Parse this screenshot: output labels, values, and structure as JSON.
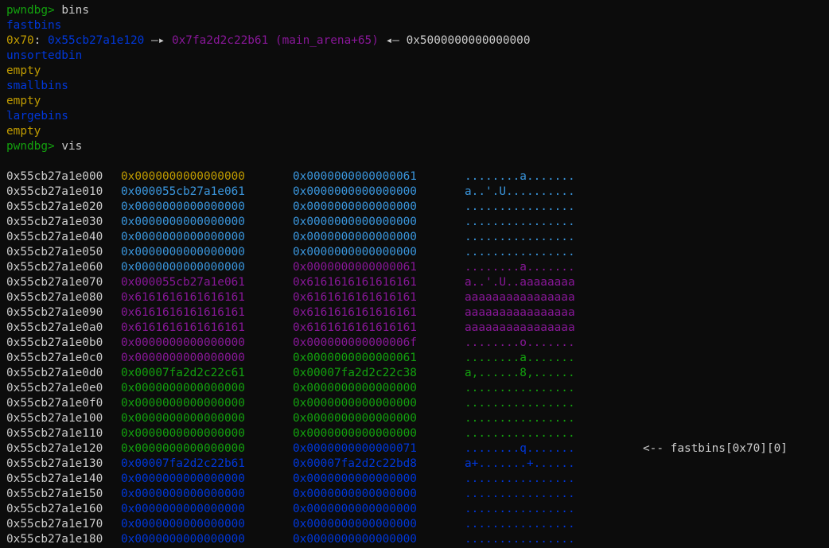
{
  "prompt": "pwndbg>",
  "bins_cmd": {
    "command": "bins",
    "fastbins_label": "fastbins",
    "fastbin_size": "0x70",
    "fastbin_colon": ":",
    "fastbin_chunk": "0x55cb27a1e120",
    "arrow1": "—▸",
    "fastbin_target": "0x7fa2d2c22b61 (main_arena+65)",
    "arrow2": "◂—",
    "fastbin_value": "0x5000000000000000",
    "unsortedbin_label": "unsortedbin",
    "unsortedbin_value": "empty",
    "smallbins_label": "smallbins",
    "smallbins_value": "empty",
    "largebins_label": "largebins",
    "largebins_value": "empty"
  },
  "vis_cmd": {
    "command": "vis"
  },
  "colors": {
    "prompt": "#13a10e",
    "text": "#cccccc",
    "label_blue": "#0037da",
    "empty_yellow": "#c19c00",
    "chunk_top_yellow": "#c19c00",
    "chunk_cyan": "#3a96dd",
    "chunk_purple": "#881798",
    "chunk_green": "#13a10e",
    "chunk_blue": "#0037da"
  },
  "rows": [
    {
      "addr": "0x55cb27a1e000",
      "q1": "0x0000000000000000",
      "q2": "0x0000000000000061",
      "ascii": "........a.......",
      "c1": "yellow",
      "c2": "cyan",
      "ca": "cyan",
      "anno": ""
    },
    {
      "addr": "0x55cb27a1e010",
      "q1": "0x000055cb27a1e061",
      "q2": "0x0000000000000000",
      "ascii": "a..'.U..........",
      "c1": "cyan",
      "c2": "cyan",
      "ca": "cyan",
      "anno": ""
    },
    {
      "addr": "0x55cb27a1e020",
      "q1": "0x0000000000000000",
      "q2": "0x0000000000000000",
      "ascii": "................",
      "c1": "cyan",
      "c2": "cyan",
      "ca": "cyan",
      "anno": ""
    },
    {
      "addr": "0x55cb27a1e030",
      "q1": "0x0000000000000000",
      "q2": "0x0000000000000000",
      "ascii": "................",
      "c1": "cyan",
      "c2": "cyan",
      "ca": "cyan",
      "anno": ""
    },
    {
      "addr": "0x55cb27a1e040",
      "q1": "0x0000000000000000",
      "q2": "0x0000000000000000",
      "ascii": "................",
      "c1": "cyan",
      "c2": "cyan",
      "ca": "cyan",
      "anno": ""
    },
    {
      "addr": "0x55cb27a1e050",
      "q1": "0x0000000000000000",
      "q2": "0x0000000000000000",
      "ascii": "................",
      "c1": "cyan",
      "c2": "cyan",
      "ca": "cyan",
      "anno": ""
    },
    {
      "addr": "0x55cb27a1e060",
      "q1": "0x0000000000000000",
      "q2": "0x0000000000000061",
      "ascii": "........a.......",
      "c1": "cyan",
      "c2": "purple",
      "ca": "purple",
      "anno": ""
    },
    {
      "addr": "0x55cb27a1e070",
      "q1": "0x000055cb27a1e061",
      "q2": "0x6161616161616161",
      "ascii": "a..'.U..aaaaaaaa",
      "c1": "purple",
      "c2": "purple",
      "ca": "purple",
      "anno": ""
    },
    {
      "addr": "0x55cb27a1e080",
      "q1": "0x6161616161616161",
      "q2": "0x6161616161616161",
      "ascii": "aaaaaaaaaaaaaaaa",
      "c1": "purple",
      "c2": "purple",
      "ca": "purple",
      "anno": ""
    },
    {
      "addr": "0x55cb27a1e090",
      "q1": "0x6161616161616161",
      "q2": "0x6161616161616161",
      "ascii": "aaaaaaaaaaaaaaaa",
      "c1": "purple",
      "c2": "purple",
      "ca": "purple",
      "anno": ""
    },
    {
      "addr": "0x55cb27a1e0a0",
      "q1": "0x6161616161616161",
      "q2": "0x6161616161616161",
      "ascii": "aaaaaaaaaaaaaaaa",
      "c1": "purple",
      "c2": "purple",
      "ca": "purple",
      "anno": ""
    },
    {
      "addr": "0x55cb27a1e0b0",
      "q1": "0x0000000000000000",
      "q2": "0x000000000000006f",
      "ascii": "........o.......",
      "c1": "purple",
      "c2": "purple",
      "ca": "purple",
      "anno": ""
    },
    {
      "addr": "0x55cb27a1e0c0",
      "q1": "0x0000000000000000",
      "q2": "0x0000000000000061",
      "ascii": "........a.......",
      "c1": "purple",
      "c2": "green",
      "ca": "green",
      "anno": ""
    },
    {
      "addr": "0x55cb27a1e0d0",
      "q1": "0x00007fa2d2c22c61",
      "q2": "0x00007fa2d2c22c38",
      "ascii": "a,......8,......",
      "c1": "green",
      "c2": "green",
      "ca": "green",
      "anno": ""
    },
    {
      "addr": "0x55cb27a1e0e0",
      "q1": "0x0000000000000000",
      "q2": "0x0000000000000000",
      "ascii": "................",
      "c1": "green",
      "c2": "green",
      "ca": "green",
      "anno": ""
    },
    {
      "addr": "0x55cb27a1e0f0",
      "q1": "0x0000000000000000",
      "q2": "0x0000000000000000",
      "ascii": "................",
      "c1": "green",
      "c2": "green",
      "ca": "green",
      "anno": ""
    },
    {
      "addr": "0x55cb27a1e100",
      "q1": "0x0000000000000000",
      "q2": "0x0000000000000000",
      "ascii": "................",
      "c1": "green",
      "c2": "green",
      "ca": "green",
      "anno": ""
    },
    {
      "addr": "0x55cb27a1e110",
      "q1": "0x0000000000000000",
      "q2": "0x0000000000000000",
      "ascii": "................",
      "c1": "green",
      "c2": "green",
      "ca": "green",
      "anno": ""
    },
    {
      "addr": "0x55cb27a1e120",
      "q1": "0x0000000000000000",
      "q2": "0x0000000000000071",
      "ascii": "........q.......",
      "c1": "green",
      "c2": "blue",
      "ca": "blue",
      "anno": "<-- fastbins[0x70][0]"
    },
    {
      "addr": "0x55cb27a1e130",
      "q1": "0x00007fa2d2c22b61",
      "q2": "0x00007fa2d2c22bd8",
      "ascii": "a+.......+......",
      "c1": "blue",
      "c2": "blue",
      "ca": "blue",
      "anno": ""
    },
    {
      "addr": "0x55cb27a1e140",
      "q1": "0x0000000000000000",
      "q2": "0x0000000000000000",
      "ascii": "................",
      "c1": "blue",
      "c2": "blue",
      "ca": "blue",
      "anno": ""
    },
    {
      "addr": "0x55cb27a1e150",
      "q1": "0x0000000000000000",
      "q2": "0x0000000000000000",
      "ascii": "................",
      "c1": "blue",
      "c2": "blue",
      "ca": "blue",
      "anno": ""
    },
    {
      "addr": "0x55cb27a1e160",
      "q1": "0x0000000000000000",
      "q2": "0x0000000000000000",
      "ascii": "................",
      "c1": "blue",
      "c2": "blue",
      "ca": "blue",
      "anno": ""
    },
    {
      "addr": "0x55cb27a1e170",
      "q1": "0x0000000000000000",
      "q2": "0x0000000000000000",
      "ascii": "................",
      "c1": "blue",
      "c2": "blue",
      "ca": "blue",
      "anno": ""
    },
    {
      "addr": "0x55cb27a1e180",
      "q1": "0x0000000000000000",
      "q2": "0x0000000000000000",
      "ascii": "................",
      "c1": "blue",
      "c2": "blue",
      "ca": "blue",
      "anno": ""
    }
  ]
}
